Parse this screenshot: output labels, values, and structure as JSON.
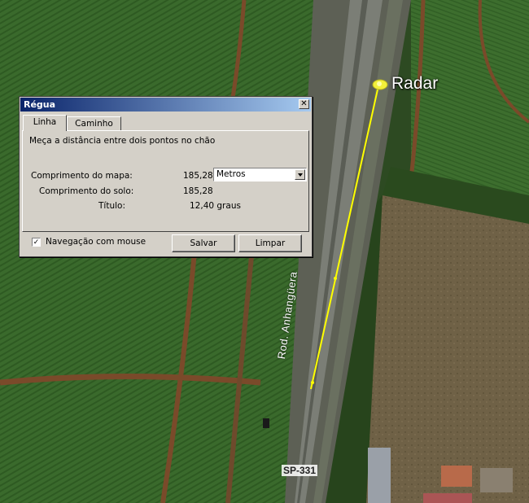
{
  "map": {
    "placemark_label": "Radar",
    "road_label": "Rod. Anhangüera",
    "route_shield": "SP-331",
    "measure_line_color": "#ffff00",
    "placemark_icon": "pushpin-icon"
  },
  "dialog": {
    "title": "Régua",
    "close_label": "✕",
    "tabs": [
      {
        "label": "Linha",
        "active": true
      },
      {
        "label": "Caminho",
        "active": false
      }
    ],
    "description": "Meça a distância entre dois pontos no chão",
    "map_length_label": "Comprimento do mapa:",
    "map_length_value": "185,28",
    "unit_selected": "Metros",
    "ground_length_label": "Comprimento do solo:",
    "ground_length_value": "185,28",
    "heading_label": "Título:",
    "heading_value": "12,40 graus",
    "mouse_nav_label": "Navegação com mouse",
    "mouse_nav_checked": "✓",
    "save_label": "Salvar",
    "clear_label": "Limpar"
  }
}
